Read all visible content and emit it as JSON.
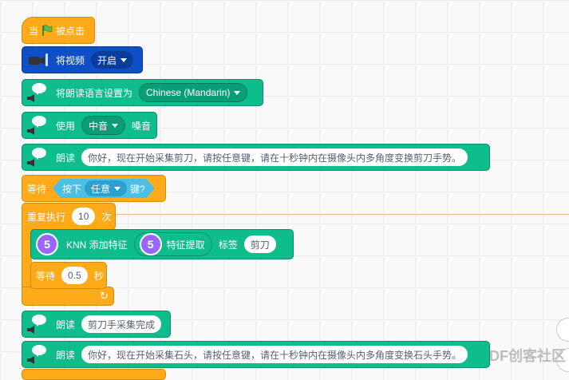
{
  "script": {
    "hat": {
      "label_when": "当",
      "label_clicked": "被点击"
    },
    "video": {
      "label": "将视频",
      "value": "开启"
    },
    "set_language": {
      "label": "将朗读语言设置为",
      "value": "Chinese (Mandarin)"
    },
    "use_voice": {
      "label_use": "使用",
      "value": "中音",
      "label_voice": "嗓音"
    },
    "speak1": {
      "label": "朗读",
      "text": "你好，现在开始采集剪刀，请按任意键，请在十秒钟内在摄像头内多角度变换剪刀手势。"
    },
    "wait_key": {
      "label_wait": "等待",
      "label_press": "按下",
      "value": "任意",
      "label_key": "键?"
    },
    "repeat": {
      "label": "重复执行",
      "count": "10",
      "label_times": "次"
    },
    "knn": {
      "badge": "5",
      "label": "KNN 添加特征",
      "inner_badge": "5",
      "inner_label": "特征提取",
      "label_tag": "标签",
      "tag": "剪刀"
    },
    "wait_secs": {
      "label_wait": "等待",
      "value": "0.5",
      "label_secs": "秒"
    },
    "speak2": {
      "label": "朗读",
      "text": "剪刀手采集完成"
    },
    "speak3": {
      "label": "朗读",
      "text": "你好，现在开始采集石头，请按任意键，请在十秒钟内在摄像头内多角度变换石头手势。"
    },
    "watermark": "DF创客社区"
  },
  "colors": {
    "events": "#ffab19",
    "extension": "#0fbd8c",
    "video": "#0e4fc7",
    "ml": "#9966ff",
    "sensing": "#4cbfe6"
  }
}
